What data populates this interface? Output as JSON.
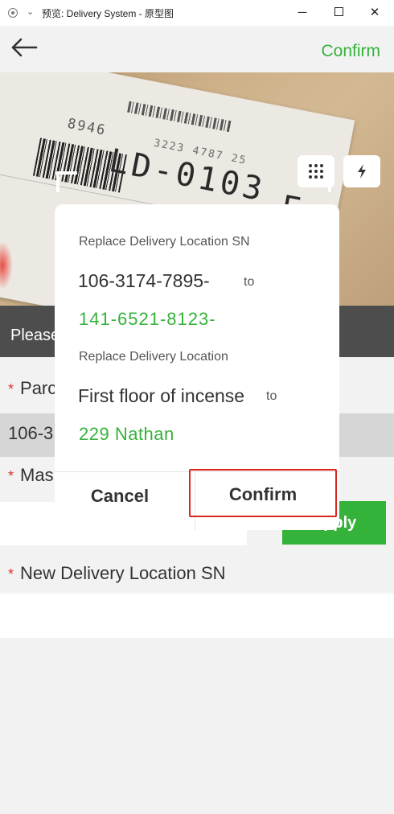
{
  "window": {
    "title": "预览: Delivery System - 原型图",
    "chevron": "⌄",
    "minimize": "─",
    "close": "✕"
  },
  "header": {
    "back_icon": "back-arrow-icon",
    "confirm_label": "Confirm"
  },
  "camera": {
    "label_numbers": [
      "8946",
      "3223 4787 25",
      "LD-0103",
      "F"
    ],
    "keypad_icon": "keypad-icon",
    "flash_icon": "flash-icon"
  },
  "prompt": {
    "text": "Please"
  },
  "form": {
    "required_mark": "*",
    "parcel_label": "Parc",
    "parcel_value": "106-3",
    "master_label": "Mas",
    "master_value": "",
    "apply_label": "Apply",
    "new_location_label": "New Delivery Location SN",
    "new_location_value": ""
  },
  "dialog": {
    "sn_label": "Replace Delivery Location SN",
    "sn_old": "106-3174-7895-",
    "sn_to": "to",
    "sn_new": "141-6521-8123-",
    "loc_label": "Replace Delivery Location",
    "loc_old": "First floor of incense",
    "loc_to": "to",
    "loc_new": "229 Nathan",
    "cancel_label": "Cancel",
    "confirm_label": "Confirm"
  },
  "colors": {
    "accent_green": "#35b23a",
    "highlight_red": "#d9271f",
    "prompt_band": "#4d4d4d"
  }
}
